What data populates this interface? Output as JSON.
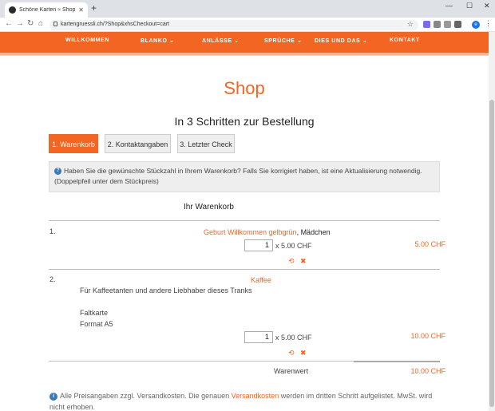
{
  "browser": {
    "tab_title": "Schöne Karten ≈ Shop",
    "url": "kartengruessli.ch/?Shop&xhsCheckout=cart",
    "profile_initial": "e"
  },
  "nav": {
    "items": [
      "WILLKOMMEN",
      "BLANKO",
      "ANLÄSSE",
      "SPRÜCHE",
      "DIES UND DAS",
      "KONTAKT"
    ]
  },
  "page": {
    "title": "Shop",
    "steps_heading": "In 3 Schritten zur Bestellung",
    "steps": [
      "1. Warenkorb",
      "2. Kontaktangaben",
      "3. Letzter Check"
    ],
    "info_text": "Haben Sie die gewünschte Stückzahl in Ihrem Warenkorb? Falls Sie korrigiert haben, ist eine Aktualisierung notwendig. (Doppelpfeil unter dem Stückpreis)",
    "cart_title": "Ihr Warenkorb"
  },
  "cart": {
    "items": [
      {
        "pos": "1.",
        "name": "Geburt Willkommen gelbgrün",
        "variant": ", Mädchen",
        "qty": "1",
        "unit_price": "x 5.00 CHF",
        "total": "5.00 CHF"
      },
      {
        "pos": "2.",
        "name": "Kaffee",
        "desc1": "Für Kaffeetanten und andere Liebhaber dieses Tranks",
        "desc2": "Faltkarte",
        "desc3": "Format A5",
        "qty": "1",
        "unit_price": "x 5.00 CHF",
        "total": "10.00 CHF"
      }
    ],
    "subtotal_label": "Warenwert",
    "subtotal": "10.00 CHF"
  },
  "footer_note": {
    "before": "Alle Preisangaben zzgl. Versandkosten. Die genauen ",
    "link": "Versandkosten",
    "after": " werden im dritten Schritt aufgelistet. MwSt. wird nicht erhoben."
  },
  "colors": {
    "accent": "#f26522",
    "info_icon": "#3a7ab8"
  }
}
